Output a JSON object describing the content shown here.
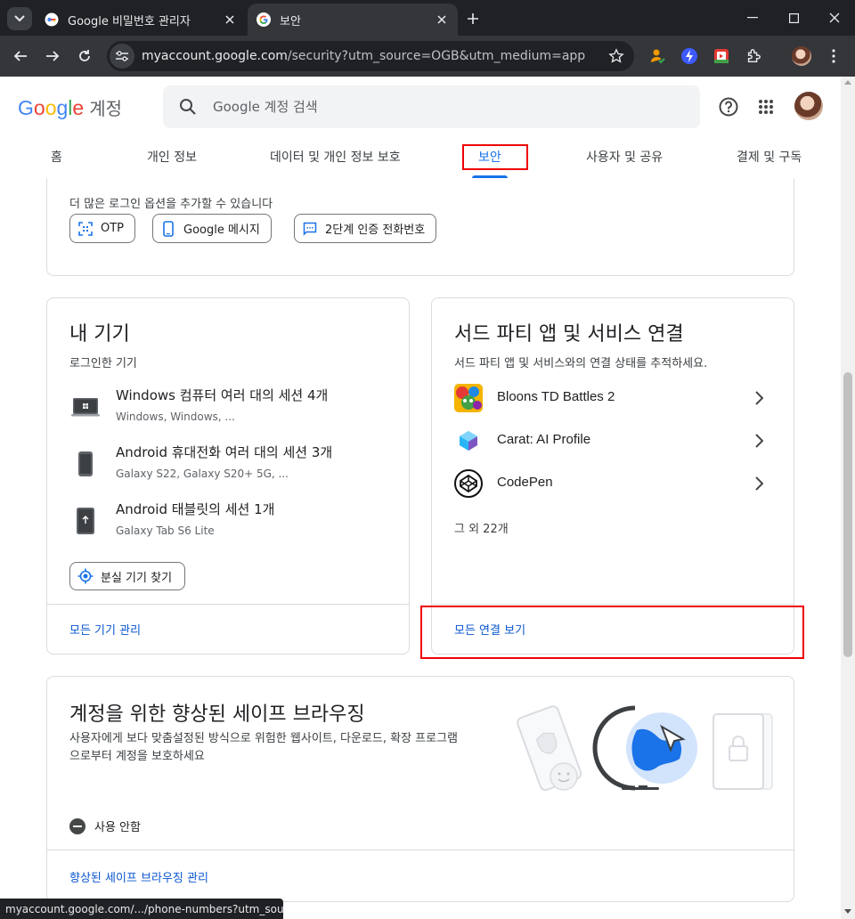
{
  "browser": {
    "tabs": [
      {
        "title": "Google 비밀번호 관리자",
        "favicon": "password-manager-icon",
        "active": false
      },
      {
        "title": "보안",
        "favicon": "google-g-icon",
        "active": true
      }
    ],
    "url_host": "myaccount.google.com",
    "url_path": "/security?utm_source=OGB&utm_medium=app",
    "status_url": "myaccount.google.com/.../phone-numbers?utm_sourc..."
  },
  "header": {
    "logo_text": "Google",
    "account_label": "계정",
    "search_placeholder": "Google 계정 검색"
  },
  "nav": {
    "tabs": [
      {
        "label": "홈"
      },
      {
        "label": "개인 정보"
      },
      {
        "label": "데이터 및 개인 정보 보호"
      },
      {
        "label": "보안",
        "active": true
      },
      {
        "label": "사용자 및 공유"
      },
      {
        "label": "결제 및 구독"
      }
    ]
  },
  "signin_options": {
    "text": "더 많은 로그인 옵션을 추가할 수 있습니다",
    "chips": [
      {
        "label": "OTP",
        "icon": "qr-scan-icon"
      },
      {
        "label": "Google 메시지",
        "icon": "phone-icon"
      },
      {
        "label": "2단계 인증 전화번호",
        "icon": "message-icon"
      }
    ]
  },
  "devices": {
    "title": "내 기기",
    "subtitle": "로그인한 기기",
    "items": [
      {
        "name": "Windows 컴퓨터 여러 대의 세션 4개",
        "detail": "Windows, Windows, ...",
        "icon": "laptop-icon"
      },
      {
        "name": "Android 휴대전화 여러 대의 세션 3개",
        "detail": "Galaxy S22, Galaxy S20+ 5G, ...",
        "icon": "phone-device-icon"
      },
      {
        "name": "Android 태블릿의 세션 1개",
        "detail": "Galaxy Tab S6 Lite",
        "icon": "tablet-icon"
      }
    ],
    "find_button": "분실 기기 찾기",
    "manage_link": "모든 기기 관리"
  },
  "third_party": {
    "title": "서드 파티 앱 및 서비스 연결",
    "subtitle": "서드 파티 앱 및 서비스와의 연결 상태를 추적하세요.",
    "apps": [
      {
        "name": "Bloons TD Battles 2"
      },
      {
        "name": "Carat: AI Profile"
      },
      {
        "name": "CodePen"
      }
    ],
    "more_text": "그 외 22개",
    "view_all_link": "모든 연결 보기"
  },
  "safe_browsing": {
    "title": "계정을 위한 향상된 세이프 브라우징",
    "description": "사용자에게 보다 맞춤설정된 방식으로 위험한 웹사이트, 다운로드, 확장 프로그램으로부터 계정을 보호하세요",
    "status": "사용 안함",
    "manage_link": "향상된 세이프 브라우징 관리"
  },
  "colors": {
    "accent": "#1a73e8",
    "link": "#0b57d0",
    "highlight": "#ee0000"
  }
}
